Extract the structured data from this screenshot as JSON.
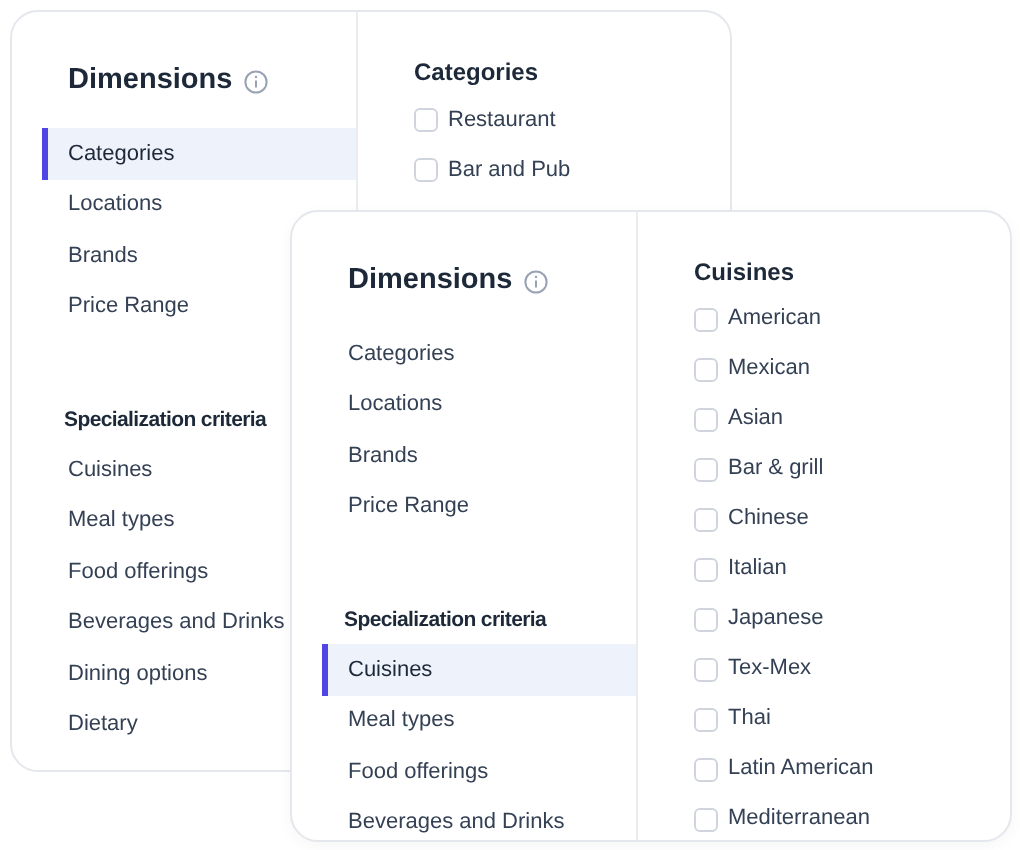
{
  "panels": [
    {
      "title": "Dimensions",
      "dimension_items": [
        {
          "label": "Categories",
          "selected": true
        },
        {
          "label": "Locations",
          "selected": false
        },
        {
          "label": "Brands",
          "selected": false
        },
        {
          "label": "Price Range",
          "selected": false
        }
      ],
      "criteria_title": "Specialization criteria",
      "criteria_items": [
        {
          "label": "Cuisines",
          "selected": false
        },
        {
          "label": "Meal types",
          "selected": false
        },
        {
          "label": "Food offerings",
          "selected": false
        },
        {
          "label": "Beverages and Drinks",
          "selected": false
        },
        {
          "label": "Dining options",
          "selected": false
        },
        {
          "label": "Dietary",
          "selected": false
        }
      ],
      "content_title": "Categories",
      "options": [
        {
          "label": "Restaurant",
          "checked": false
        },
        {
          "label": "Bar and Pub",
          "checked": false
        }
      ]
    },
    {
      "title": "Dimensions",
      "dimension_items": [
        {
          "label": "Categories",
          "selected": false
        },
        {
          "label": "Locations",
          "selected": false
        },
        {
          "label": "Brands",
          "selected": false
        },
        {
          "label": "Price Range",
          "selected": false
        }
      ],
      "criteria_title": "Specialization criteria",
      "criteria_items": [
        {
          "label": "Cuisines",
          "selected": true
        },
        {
          "label": "Meal types",
          "selected": false
        },
        {
          "label": "Food offerings",
          "selected": false
        },
        {
          "label": "Beverages and Drinks",
          "selected": false
        }
      ],
      "content_title": "Cuisines",
      "options": [
        {
          "label": "American",
          "checked": false
        },
        {
          "label": "Mexican",
          "checked": false
        },
        {
          "label": "Asian",
          "checked": false
        },
        {
          "label": "Bar & grill",
          "checked": false
        },
        {
          "label": "Chinese",
          "checked": false
        },
        {
          "label": "Italian",
          "checked": false
        },
        {
          "label": "Japanese",
          "checked": false
        },
        {
          "label": "Tex-Mex",
          "checked": false
        },
        {
          "label": "Thai",
          "checked": false
        },
        {
          "label": "Latin American",
          "checked": false
        },
        {
          "label": "Mediterranean",
          "checked": false
        }
      ]
    }
  ]
}
